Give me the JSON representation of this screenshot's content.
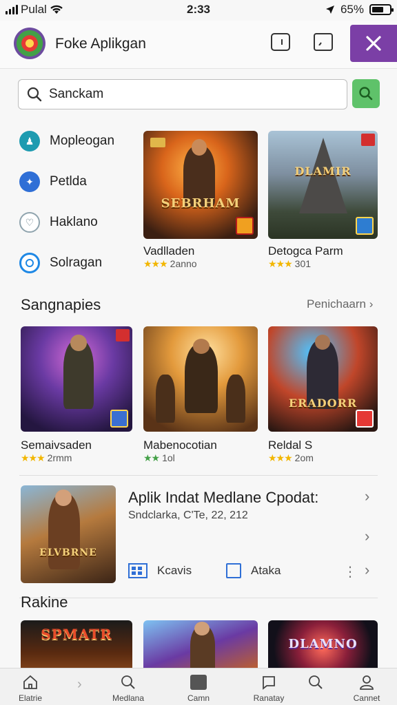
{
  "status": {
    "carrier": "Pulal",
    "time": "2:33",
    "battery": "65%",
    "battery_level": 0.65
  },
  "appbar": {
    "title": "Foke Aplikgan"
  },
  "search": {
    "value": "Sanckam"
  },
  "categories": [
    {
      "label": "Mopleogan",
      "icon": "gamepad-icon",
      "color": "#1e9bb0"
    },
    {
      "label": "Petlda",
      "icon": "puzzle-icon",
      "color": "#2f6fd6"
    },
    {
      "label": "Haklano",
      "icon": "heart-icon",
      "color": "#cfd8dc"
    },
    {
      "label": "Solragan",
      "icon": "target-icon",
      "color": "#1e88e5"
    }
  ],
  "featured": [
    {
      "title": "Vadlladen",
      "stars": "★★★",
      "rating": "2anno",
      "banner": "SEBRHAM"
    },
    {
      "title": "Detogca Parm",
      "stars": "★★★",
      "rating": "301",
      "banner": "DLAMIR"
    }
  ],
  "section1": {
    "title": "Sangnapies",
    "link": "Penichaarn"
  },
  "section1_games": [
    {
      "title": "Semaivsaden",
      "stars": "★★★",
      "rating": "2rmm",
      "star_color": "gold"
    },
    {
      "title": "Mabenocotian",
      "stars": "★★",
      "rating": "1ol",
      "star_color": "green"
    },
    {
      "title": "Reldal S",
      "stars": "★★★",
      "rating": "2om",
      "star_color": "gold",
      "banner": "ERADORR"
    }
  ],
  "update": {
    "title": "Aplik Indat Medlane Cpodat:",
    "subtitle": "Sndclarka, C'Te, 22, 212",
    "banner": "ELVBRNE",
    "action1": "Kcavis",
    "action2": "Ataka"
  },
  "section2": {
    "title": "Rakine"
  },
  "section2_banners": [
    "SPMATR",
    "",
    "DLAMNO"
  ],
  "bottom_nav": [
    {
      "label": "Elatrie",
      "icon": "home-icon"
    },
    {
      "label": "Medlana",
      "icon": "search-icon"
    },
    {
      "label": "Camn",
      "icon": "square-icon"
    },
    {
      "label": "Ranatay",
      "icon": "chat-icon"
    },
    {
      "label": "",
      "icon": "search-icon"
    },
    {
      "label": "Cannet",
      "icon": "person-icon"
    }
  ]
}
